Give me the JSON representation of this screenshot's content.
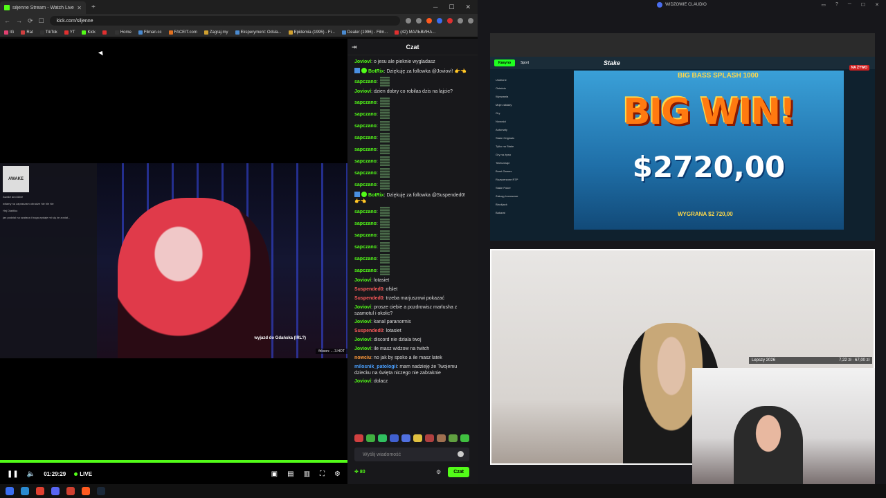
{
  "browser": {
    "tab_title": "siljenne Stream - Watch Live",
    "url": "kick.com/siljenne",
    "bookmarks": [
      "IG",
      "Rat",
      "TikTok",
      "YT",
      "Kick",
      "",
      "Home",
      "Filman.cc",
      "FACEIT.com",
      "Zagraj.my",
      "Eksperyment: Odsła...",
      "Epidemia (1995) - Fi...",
      "Dealer (1996) - Film...",
      "(42) МАЛЬВИНА..."
    ]
  },
  "player": {
    "time": "01:29:29",
    "live_label": "LIVE",
    "stream_caption": "wyjazd do Gdańska (IRL?)",
    "ticker": "frikson: ... 3.HOT",
    "album_label": "AWAKE",
    "overlay_msgs": [
      "Awake and Alive",
      "witamy na zapraszam obradze hle hle hle",
      "Hej Diabliku",
      "jan podzial na szatana i boga wydaje mi się że został..."
    ]
  },
  "chat": {
    "title": "Czat",
    "input_placeholder": "Wyślij wiadomość",
    "points": "80",
    "send_label": "Czat",
    "messages": [
      {
        "user": "Jovioví",
        "color": "#53fc18",
        "text": ": o jesu ale pieknie wygladasz",
        "type": "text"
      },
      {
        "user": "BotRix",
        "color": "#53fc18",
        "text": ": Dziękuję za followka @Jovioví! 👉👈",
        "type": "bot"
      },
      {
        "user": "sapczano",
        "color": "#53fc18",
        "text": ":",
        "type": "emote"
      },
      {
        "user": "Jovioví",
        "color": "#53fc18",
        "text": ": dzien dobry co robilas dzis na lajcie?",
        "type": "text"
      },
      {
        "user": "sapczano",
        "color": "#53fc18",
        "text": ":",
        "type": "emote"
      },
      {
        "user": "sapczano",
        "color": "#53fc18",
        "text": ":",
        "type": "emote"
      },
      {
        "user": "sapczano",
        "color": "#53fc18",
        "text": ":",
        "type": "emote"
      },
      {
        "user": "sapczano",
        "color": "#53fc18",
        "text": ":",
        "type": "emote"
      },
      {
        "user": "sapczano",
        "color": "#53fc18",
        "text": ":",
        "type": "emote"
      },
      {
        "user": "sapczano",
        "color": "#53fc18",
        "text": ":",
        "type": "emote"
      },
      {
        "user": "sapczano",
        "color": "#53fc18",
        "text": ":",
        "type": "emote"
      },
      {
        "user": "sapczano",
        "color": "#53fc18",
        "text": ":",
        "type": "emote"
      },
      {
        "user": "BotRix",
        "color": "#53fc18",
        "text": ": Dziękuję za followka @Suspended0! 👉👈",
        "type": "bot"
      },
      {
        "user": "sapczano",
        "color": "#53fc18",
        "text": ":",
        "type": "emote"
      },
      {
        "user": "sapczano",
        "color": "#53fc18",
        "text": ":",
        "type": "emote"
      },
      {
        "user": "sapczano",
        "color": "#53fc18",
        "text": ":",
        "type": "emote"
      },
      {
        "user": "sapczano",
        "color": "#53fc18",
        "text": ":",
        "type": "emote"
      },
      {
        "user": "sapczano",
        "color": "#53fc18",
        "text": ":",
        "type": "emote"
      },
      {
        "user": "sapczano",
        "color": "#53fc18",
        "text": ":",
        "type": "emote"
      },
      {
        "user": "Jovioví",
        "color": "#53fc18",
        "text": ": lotasiet",
        "type": "text"
      },
      {
        "user": "Suspended0",
        "color": "#ff5a5a",
        "text": ": ofslet",
        "type": "text"
      },
      {
        "user": "Suspended0",
        "color": "#ff5a5a",
        "text": ": trzeba marjuszowi pokazać",
        "type": "text"
      },
      {
        "user": "Jovioví",
        "color": "#53fc18",
        "text": ": prosze ciebie a pozdrowisz marlusha z szamotul i okolic?",
        "type": "text"
      },
      {
        "user": "Jovioví",
        "color": "#53fc18",
        "text": ": kanal paranormis",
        "type": "text"
      },
      {
        "user": "Suspended0",
        "color": "#ff5a5a",
        "text": ": lotasiet",
        "type": "text"
      },
      {
        "user": "Jovioví",
        "color": "#53fc18",
        "text": ": discord nie dziala twoj",
        "type": "text"
      },
      {
        "user": "Jovioví",
        "color": "#53fc18",
        "text": ": ile masz widzow na twitch",
        "type": "text"
      },
      {
        "user": "nowciu",
        "color": "#ff9a3a",
        "text": ": no jak by spoko a ile masz latek",
        "type": "text"
      },
      {
        "user": "milosnik_patologii",
        "color": "#4aa0ff",
        "text": ": mam nadzieję że Twojemu dziecku na święta niczego nie zabraknie",
        "type": "text"
      },
      {
        "user": "Jovioví",
        "color": "#53fc18",
        "text": ": dolacz",
        "type": "text"
      }
    ]
  },
  "right": {
    "header": "WIDZOWIE CLAUDIO",
    "slot_title": "BIG BASS SPLASH 1000",
    "big_win": "BIG WIN!",
    "amount": "$2720,00",
    "wygrana": "WYGRANA $2 720,00",
    "live_badge": "NA ŻYWO",
    "stake_tabs": [
      "Kasyno",
      "Sport"
    ],
    "stake_logo": "Stake",
    "stake_side": [
      "Ulubione",
      "Ostatnio",
      "Wyzwania",
      "Moje zakłady",
      "Gry",
      "Nowości",
      "Automaty",
      "Stake Originals",
      "Tylko na Stake",
      "Gry na żywo",
      "Teleturniaje",
      "Burst Games",
      "Rozszerzone RTP",
      "Stake Poker",
      "Zakupy bonusowe",
      "Blackjack",
      "Bakarat"
    ],
    "cam_label_left": "Lepszy 2026",
    "cam_label_right": "7,22 zł · 67,00 zł"
  }
}
